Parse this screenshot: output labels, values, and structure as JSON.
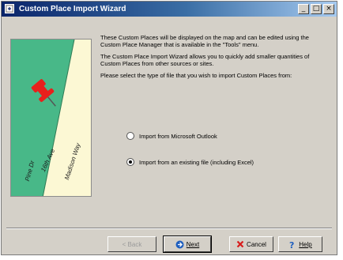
{
  "window": {
    "title": "Custom Place Import Wizard",
    "title_buttons": [
      "_",
      "□",
      "×"
    ]
  },
  "illustration": {
    "streets": [
      "Pine Dr",
      "16th Ave",
      "Madison Way"
    ],
    "colors": {
      "grass": "#48b888",
      "road": "#fcf8d4",
      "pin": "#e8201c"
    }
  },
  "description": {
    "paragraph1": "These Custom Places will be displayed on the map and can be edited using the Custom Place Manager that is available in the \"Tools\" menu.",
    "paragraph2": "The Custom Place Import Wizard allows you to quickly add smaller quantities of Custom Places from other sources or sites.",
    "paragraph3": "Please select the type of file that you wish to import Custom Places from:"
  },
  "options": {
    "outlook": {
      "label": "Import from Microsoft Outlook",
      "selected": false
    },
    "file": {
      "label": "Import from an existing file (including Excel)",
      "selected": true
    }
  },
  "buttons": {
    "back": "< Back",
    "next": "Next",
    "cancel": "Cancel",
    "help": "Help"
  },
  "colors": {
    "titlebar_start": "#0a246a",
    "titlebar_end": "#a6caf0",
    "face": "#d4d0c8"
  }
}
